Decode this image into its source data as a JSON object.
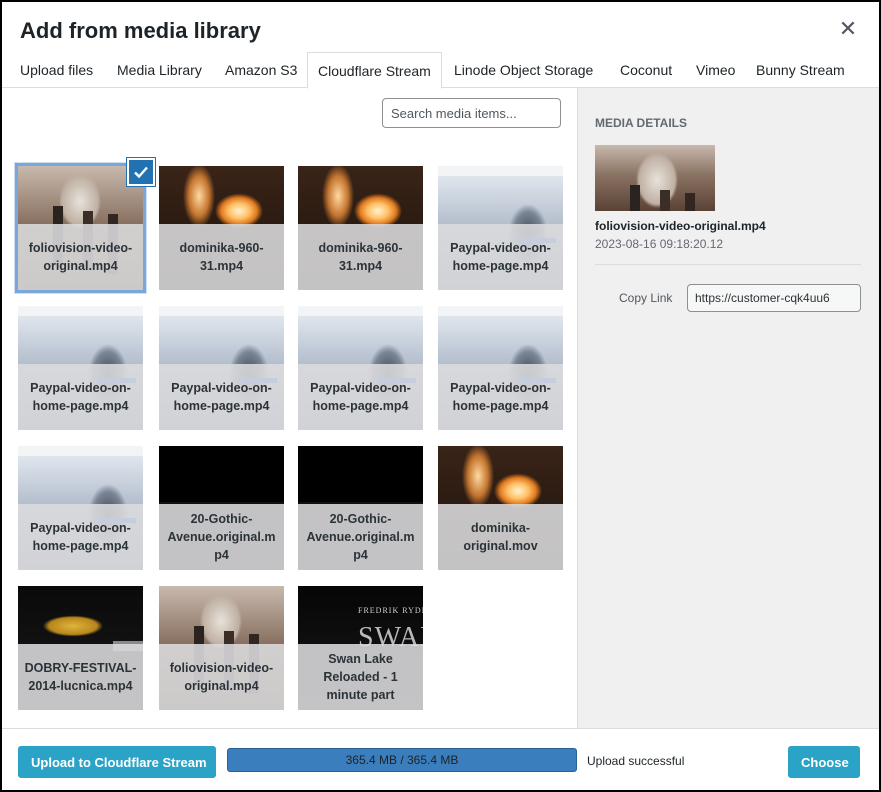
{
  "modal": {
    "title": "Add from media library",
    "close_icon": "close-icon"
  },
  "tabs": [
    {
      "label": "Upload files",
      "active": false
    },
    {
      "label": "Media Library",
      "active": false
    },
    {
      "label": "Amazon S3",
      "active": false
    },
    {
      "label": "Cloudflare Stream",
      "active": true
    },
    {
      "label": "Linode Object Storage",
      "active": false
    },
    {
      "label": "Coconut",
      "active": false
    },
    {
      "label": "Vimeo",
      "active": false
    },
    {
      "label": "Bunny Stream",
      "active": false
    }
  ],
  "search": {
    "placeholder": "Search media items..."
  },
  "media_items": [
    {
      "name": "foliovision-video-original.mp4",
      "thumb": "hall",
      "selected": true
    },
    {
      "name": "dominika-960-31.mp4",
      "thumb": "fire",
      "selected": false
    },
    {
      "name": "dominika-960-31.mp4",
      "thumb": "fire",
      "selected": false
    },
    {
      "name": "Paypal-video-on-home-page.mp4",
      "thumb": "paypal",
      "selected": false
    },
    {
      "name": "Paypal-video-on-home-page.mp4",
      "thumb": "paypal",
      "selected": false
    },
    {
      "name": "Paypal-video-on-home-page.mp4",
      "thumb": "paypal",
      "selected": false
    },
    {
      "name": "Paypal-video-on-home-page.mp4",
      "thumb": "paypal",
      "selected": false
    },
    {
      "name": "Paypal-video-on-home-page.mp4",
      "thumb": "paypal",
      "selected": false
    },
    {
      "name": "Paypal-video-on-home-page.mp4",
      "thumb": "paypal",
      "selected": false
    },
    {
      "name": "20-Gothic-Avenue.original.mp4",
      "thumb": "black",
      "selected": false
    },
    {
      "name": "20-Gothic-Avenue.original.mp4",
      "thumb": "black",
      "selected": false
    },
    {
      "name": "dominika-original.mov",
      "thumb": "fire",
      "selected": false
    },
    {
      "name": "DOBRY-FESTIVAL-2014-lucnica.mp4",
      "thumb": "festival",
      "selected": false
    },
    {
      "name": "foliovision-video-original.mp4",
      "thumb": "hall",
      "selected": false
    },
    {
      "name": "Swan Lake Reloaded - 1 minute part",
      "thumb": "swan",
      "selected": false
    }
  ],
  "swan_thumb": {
    "credit": "FREDRIK RYDMAN",
    "word": "SWAN"
  },
  "details": {
    "heading": "Media Details",
    "filename": "foliovision-video-original.mp4",
    "date": "2023-08-16 09:18:20.12",
    "copy_link_label": "Copy Link",
    "copy_link_value": "https://customer-cqk4uu6"
  },
  "footer": {
    "upload_button": "Upload to Cloudflare Stream",
    "progress_text": "365.4 MB / 365.4 MB",
    "progress_percent": 100,
    "status": "Upload successful",
    "choose_button": "Choose"
  },
  "colors": {
    "primary_button": "#2ba3c7",
    "progress_bar": "#3479b8",
    "selected_check": "#2271b1"
  }
}
